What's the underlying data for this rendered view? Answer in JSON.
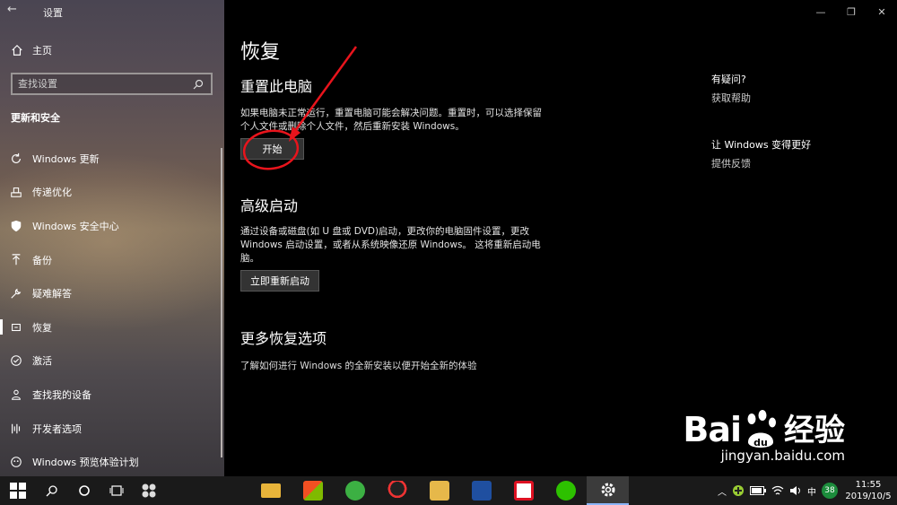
{
  "window": {
    "title": "设置",
    "back": "←",
    "minimize": "—",
    "restore": "❐",
    "close": "✕"
  },
  "sidebar": {
    "home_label": "主页",
    "search_placeholder": "查找设置",
    "section_title": "更新和安全",
    "items": [
      {
        "label": "Windows 更新",
        "icon": "refresh-icon"
      },
      {
        "label": "传递优化",
        "icon": "delivery-icon"
      },
      {
        "label": "Windows 安全中心",
        "icon": "shield-icon"
      },
      {
        "label": "备份",
        "icon": "backup-arrow-icon"
      },
      {
        "label": "疑难解答",
        "icon": "wrench-icon"
      },
      {
        "label": "恢复",
        "icon": "recovery-icon",
        "active": true
      },
      {
        "label": "激活",
        "icon": "check-circle-icon"
      },
      {
        "label": "查找我的设备",
        "icon": "person-pin-icon"
      },
      {
        "label": "开发者选项",
        "icon": "developer-icon"
      },
      {
        "label": "Windows 预览体验计划",
        "icon": "insider-icon"
      }
    ]
  },
  "main": {
    "page_title": "恢复",
    "reset": {
      "heading": "重置此电脑",
      "desc_line1": "如果电脑未正常运行，重置电脑可能会解决问题。重置时，可以选择保留",
      "desc_line2": "个人文件或删除个人文件，然后重新安装 Windows。",
      "button": "开始"
    },
    "advanced": {
      "heading": "高级启动",
      "desc_line1": "通过设备或磁盘(如 U 盘或 DVD)启动，更改你的电脑固件设置，更改",
      "desc_line2": "Windows 启动设置，或者从系统映像还原 Windows。 这将重新启动电",
      "desc_line3": "脑。",
      "button": "立即重新启动"
    },
    "more": {
      "heading": "更多恢复选项",
      "link": "了解如何进行 Windows 的全新安装以便开始全新的体验"
    }
  },
  "right_panel": {
    "help_heading": "有疑问?",
    "help_link": "获取帮助",
    "feedback_heading": "让 Windows 变得更好",
    "feedback_link": "提供反馈"
  },
  "watermark": {
    "brand_bai": "Bai",
    "brand_du": "du",
    "brand_cn": "经验",
    "url": "jingyan.baidu.com"
  },
  "taskbar": {
    "apps": [
      "file-explorer-icon",
      "store-icon",
      "green-browser-icon",
      "qq-icon",
      "mail-icon",
      "bank-icon",
      "red-app-icon",
      "wechat-icon",
      "settings-icon"
    ],
    "tray_badge": "38",
    "time": "11:55",
    "date": "2019/10/5",
    "colors": {
      "accent": "#8ab4f8",
      "annotation": "#e8141c"
    }
  }
}
